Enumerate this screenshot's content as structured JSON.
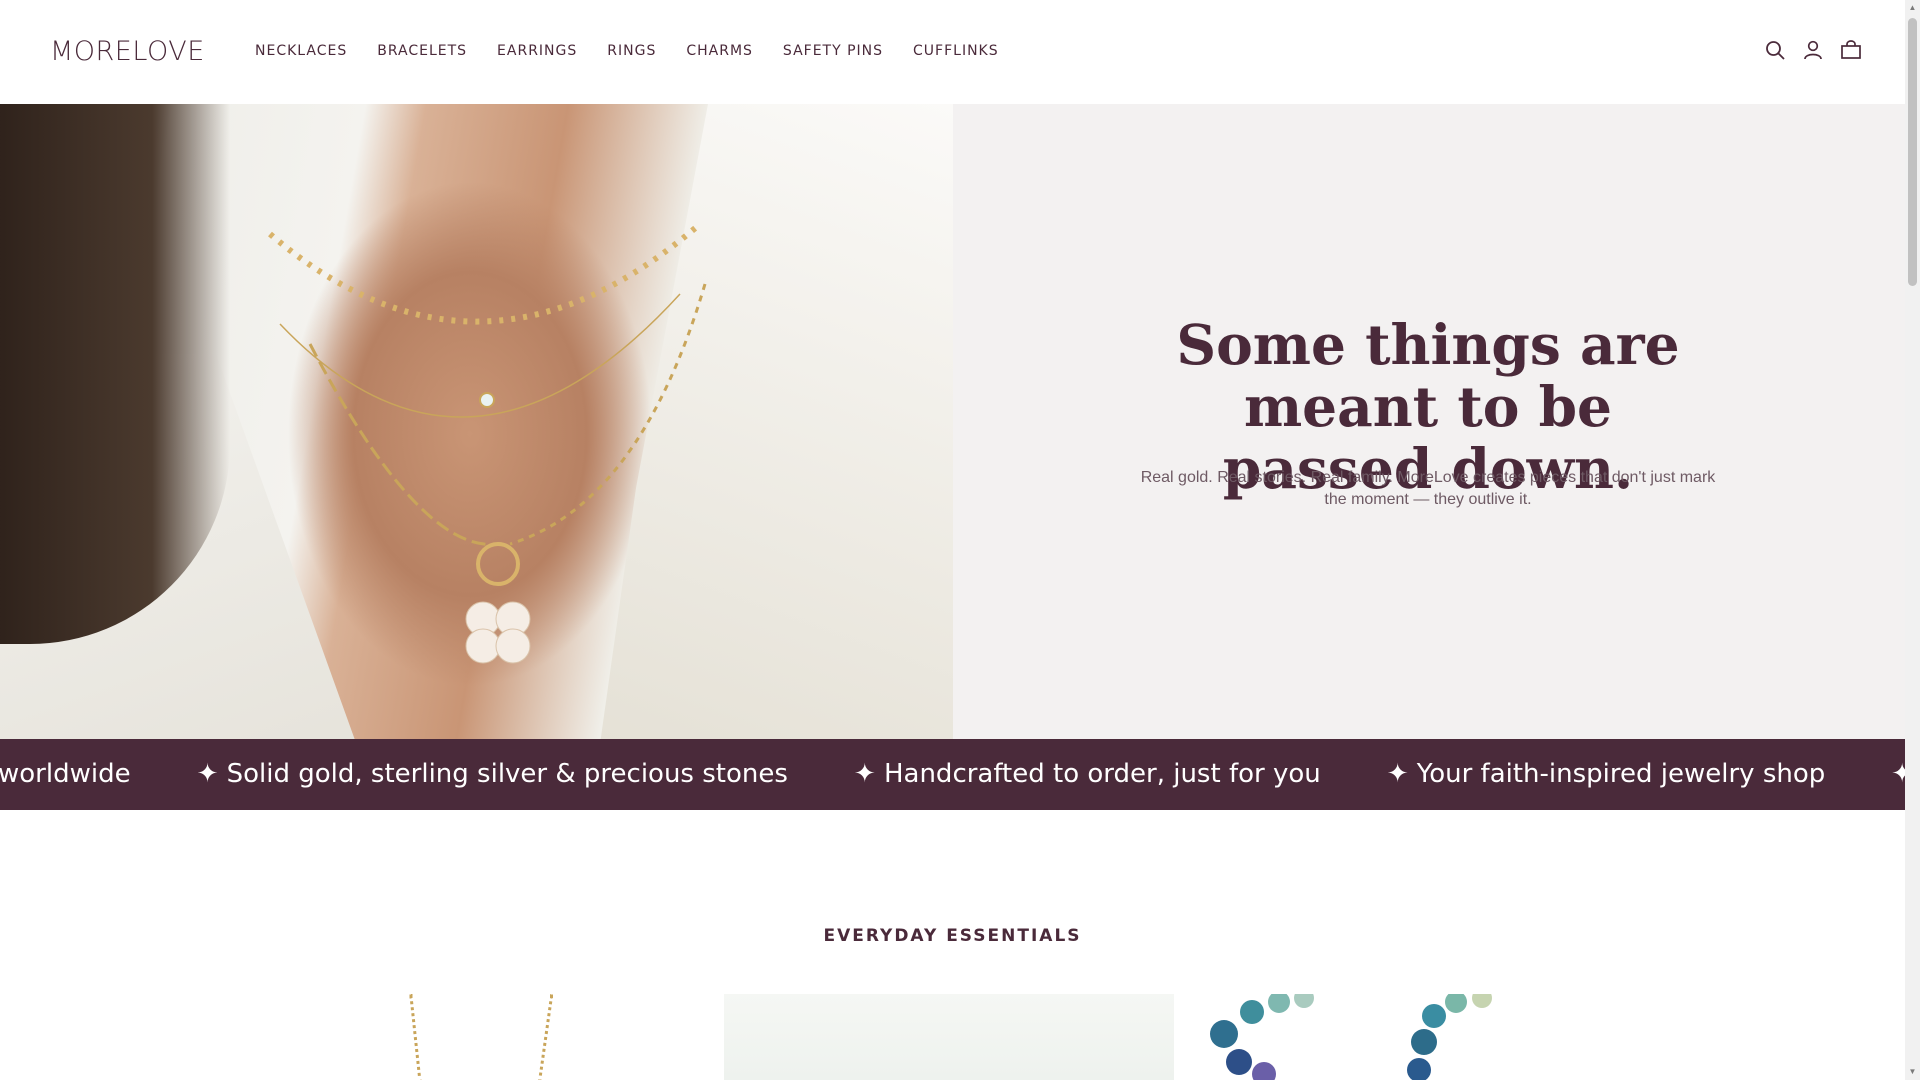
{
  "header": {
    "logo": "MORELOVE",
    "nav": [
      "NECKLACES",
      "BRACELETS",
      "EARRINGS",
      "RINGS",
      "CHARMS",
      "SAFETY PINS",
      "CUFFLINKS"
    ],
    "icons": [
      "search-icon",
      "account-icon",
      "cart-icon"
    ]
  },
  "hero": {
    "title": "Some things are meant to be passed down.",
    "subtitle": "Real gold. Real stories. Real family. MoreLove creates pieces that don't just mark the moment — they outlive it."
  },
  "marquee": {
    "items": [
      "worldwide",
      "✦ Solid gold, sterling silver & precious stones",
      "✦ Handcrafted to order, just for you",
      "✦ Your faith-inspired jewelry shop",
      "✦ Per"
    ]
  },
  "section": {
    "title": "EVERYDAY ESSENTIALS"
  },
  "colors": {
    "brand": "#4a2a3a",
    "hero_panel": "#f3f1f1",
    "white": "#ffffff"
  }
}
